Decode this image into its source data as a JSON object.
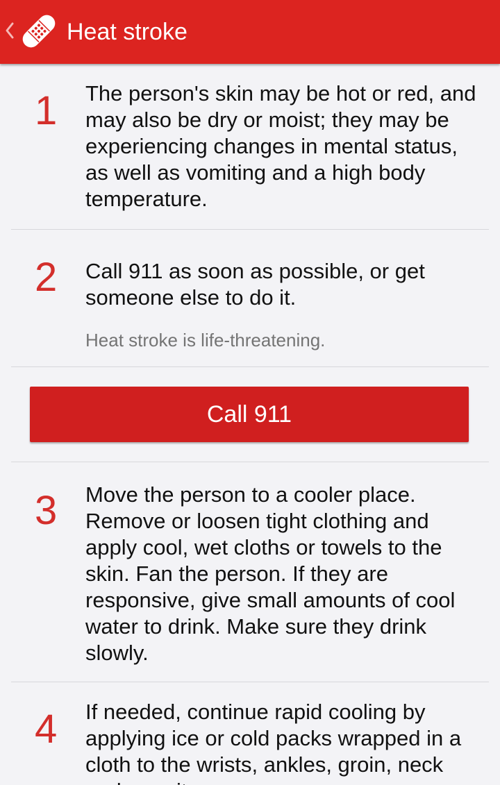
{
  "header": {
    "title": "Heat stroke",
    "back_icon": "chevron-left-icon",
    "logo_icon": "bandage-icon",
    "color": "#dc2420"
  },
  "steps": [
    {
      "number": "1",
      "text": "The person's skin may be hot or red, and may also be dry or moist; they may be experiencing changes in mental status, as well as vomiting and a high body temperature."
    },
    {
      "number": "2",
      "text": "Call 911 as soon as possible, or get someone else to do it.",
      "note": "Heat stroke is life-threatening."
    },
    {
      "number": "3",
      "text": "Move the person to a cooler place. Remove or loosen tight clothing and apply cool, wet cloths or towels to the skin. Fan the person. If they are responsive, give small amounts of cool water to drink. Make sure they drink slowly."
    },
    {
      "number": "4",
      "text": "If needed, continue rapid cooling by applying ice or cold packs wrapped in a cloth to the wrists, ankles, groin, neck and armpits."
    }
  ],
  "call_button": {
    "label": "Call 911",
    "color": "#d01f1f"
  },
  "colors": {
    "accent": "#d32e2b",
    "background": "#f3f3f6",
    "divider": "#d7d7db",
    "note_text": "#747474"
  }
}
